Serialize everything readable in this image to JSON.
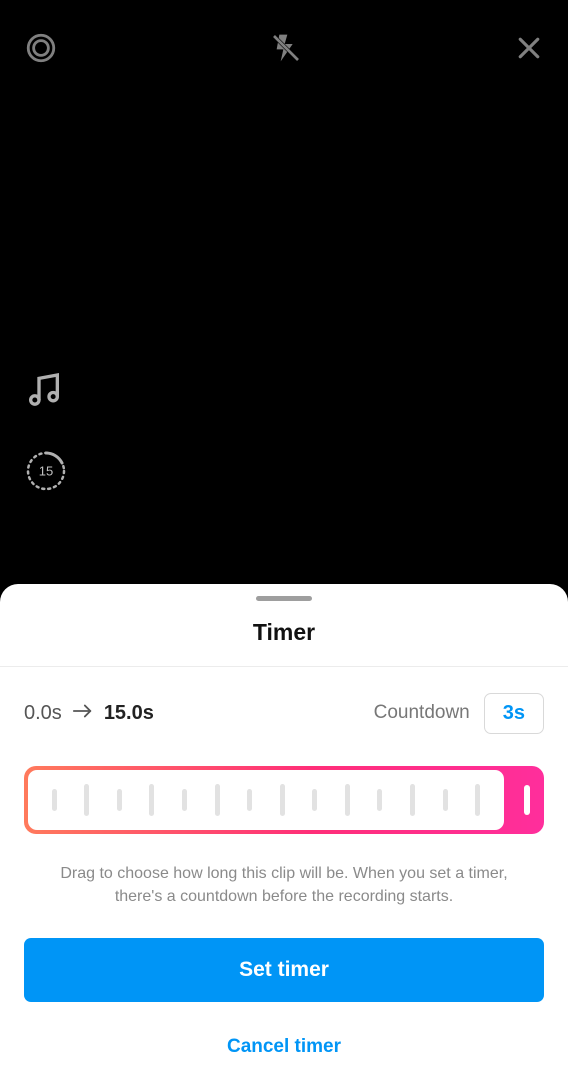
{
  "side": {
    "duration_label": "15"
  },
  "sheet": {
    "title": "Timer",
    "range_start": "0.0s",
    "range_end": "15.0s",
    "countdown_label": "Countdown",
    "countdown_value": "3s",
    "hint": "Drag to choose how long this clip will be. When you set a timer, there's a countdown before the recording starts.",
    "primary": "Set timer",
    "secondary": "Cancel timer"
  }
}
